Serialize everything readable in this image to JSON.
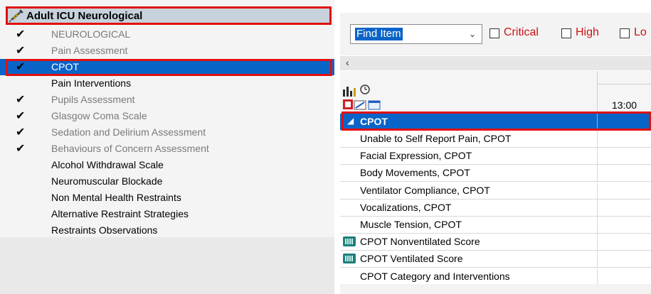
{
  "left_panel": {
    "title": "Adult ICU Neurological",
    "title_icon": "syringe-icon",
    "items": [
      {
        "label": "NEUROLOGICAL",
        "done": true
      },
      {
        "label": "Pain Assessment",
        "done": true
      },
      {
        "label": "CPOT",
        "done": true,
        "selected": true
      },
      {
        "label": "Pain Interventions",
        "done": false
      },
      {
        "label": "Pupils Assessment",
        "done": true
      },
      {
        "label": "Glasgow Coma Scale",
        "done": true
      },
      {
        "label": "Sedation and Delirium Assessment",
        "done": true
      },
      {
        "label": "Behaviours of Concern Assessment",
        "done": true
      },
      {
        "label": "Alcohol Withdrawal Scale",
        "done": false
      },
      {
        "label": "Neuromuscular Blockade",
        "done": false
      },
      {
        "label": "Non Mental Health Restraints",
        "done": false
      },
      {
        "label": "Alternative Restraint Strategies",
        "done": false
      },
      {
        "label": "Restraints Observations",
        "done": false
      }
    ]
  },
  "right_panel": {
    "find_value": "Find Item",
    "filters": [
      {
        "label": "Critical",
        "checked": false
      },
      {
        "label": "High",
        "checked": false
      },
      {
        "label": "Lo",
        "checked": false
      }
    ],
    "time_column": "13:00",
    "section_title": "CPOT",
    "rows": [
      {
        "label": "Unable to Self Report Pain, CPOT",
        "calc": false
      },
      {
        "label": "Facial Expression, CPOT",
        "calc": false
      },
      {
        "label": "Body Movements, CPOT",
        "calc": false
      },
      {
        "label": "Ventilator Compliance, CPOT",
        "calc": false
      },
      {
        "label": "Vocalizations, CPOT",
        "calc": false
      },
      {
        "label": "Muscle Tension, CPOT",
        "calc": false
      },
      {
        "label": "CPOT Nonventilated Score",
        "calc": true
      },
      {
        "label": "CPOT Ventilated Score",
        "calc": true
      },
      {
        "label": "CPOT Category and Interventions",
        "calc": false
      }
    ]
  },
  "colors": {
    "selection": "#0a64c8",
    "highlight_outline": "#e01010",
    "filter_label": "#d01010"
  }
}
